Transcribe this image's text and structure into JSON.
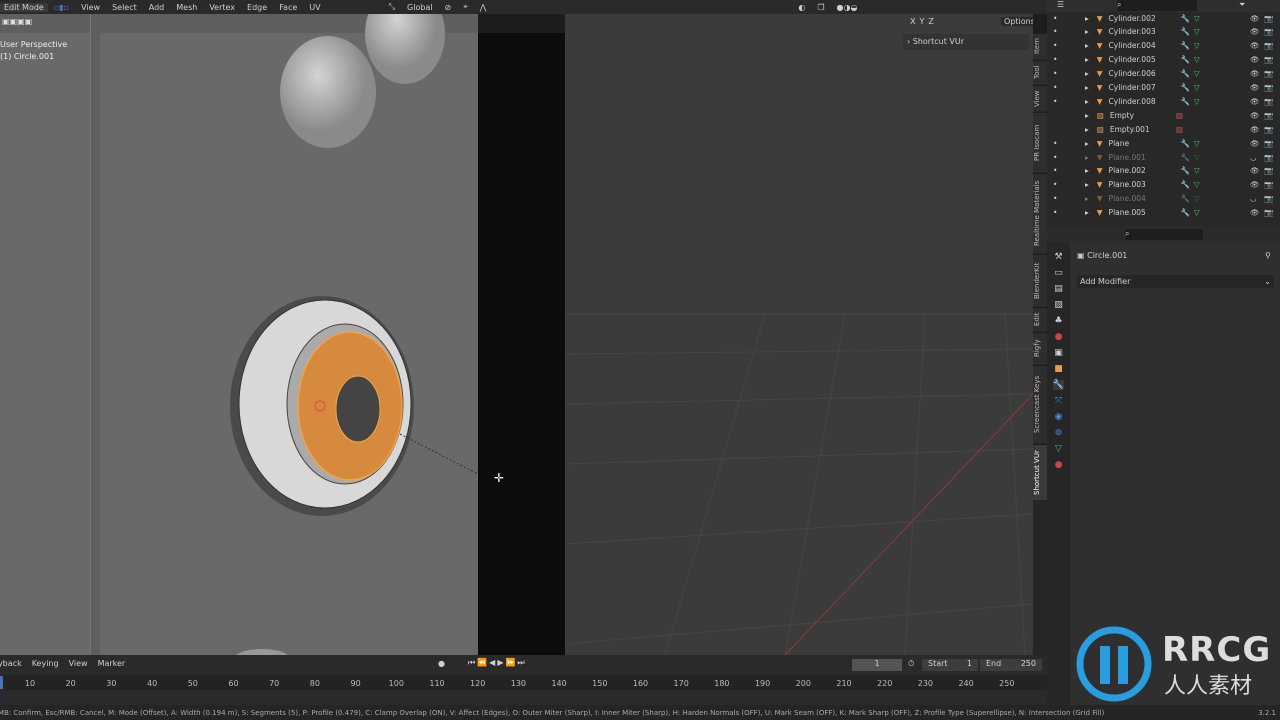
{
  "header": {
    "mode": "Edit Mode",
    "menus": [
      "View",
      "Select",
      "Add",
      "Mesh",
      "Vertex",
      "Edge",
      "Face",
      "UV"
    ],
    "orientation": "Global",
    "options": "Options",
    "axes": [
      "X",
      "Y",
      "Z"
    ]
  },
  "viewport": {
    "perspective": "User Perspective",
    "object": "(1) Circle.001"
  },
  "sidebar": {
    "panel": "Shortcut VUr",
    "tabs": [
      "Item",
      "Tool",
      "View",
      "PR Isocam",
      "Realtime Materials",
      "BlenderKit",
      "Edit",
      "Rigfy",
      "Screencast Keys",
      "Shortcut VUr"
    ]
  },
  "outliner": {
    "items": [
      {
        "name": "Cylinder.002",
        "type": "mesh",
        "dim": false
      },
      {
        "name": "Cylinder.003",
        "type": "mesh",
        "dim": false
      },
      {
        "name": "Cylinder.004",
        "type": "mesh",
        "dim": false
      },
      {
        "name": "Cylinder.005",
        "type": "mesh",
        "dim": false
      },
      {
        "name": "Cylinder.006",
        "type": "mesh",
        "dim": false
      },
      {
        "name": "Cylinder.007",
        "type": "mesh",
        "dim": false
      },
      {
        "name": "Cylinder.008",
        "type": "mesh",
        "dim": false
      },
      {
        "name": "Empty",
        "type": "empty",
        "dim": false
      },
      {
        "name": "Empty.001",
        "type": "empty",
        "dim": false
      },
      {
        "name": "Plane",
        "type": "mesh",
        "dim": false
      },
      {
        "name": "Plane.001",
        "type": "mesh",
        "dim": true
      },
      {
        "name": "Plane.002",
        "type": "mesh",
        "dim": false
      },
      {
        "name": "Plane.003",
        "type": "mesh",
        "dim": false
      },
      {
        "name": "Plane.004",
        "type": "mesh",
        "dim": true
      },
      {
        "name": "Plane.005",
        "type": "mesh",
        "dim": false
      }
    ]
  },
  "properties": {
    "object": "Circle.001",
    "add_modifier": "Add Modifier"
  },
  "timeline": {
    "menus": [
      "Playback",
      "Keying",
      "View",
      "Marker"
    ],
    "current_frame": "1",
    "start_label": "Start",
    "start": "1",
    "end_label": "End",
    "end": "250",
    "ticks": [
      "10",
      "20",
      "30",
      "40",
      "50",
      "60",
      "70",
      "80",
      "90",
      "100",
      "110",
      "120",
      "130",
      "140",
      "150",
      "160",
      "170",
      "180",
      "190",
      "200",
      "210",
      "220",
      "230",
      "240",
      "250"
    ]
  },
  "status": {
    "text": "LMB: Confirm, Esc/RMB: Cancel, M: Mode (Offset), A: Width (0.194 m), S: Segments (5), P: Profile (0.479), C: Clamp Overlap (ON), V: Affect (Edges), O: Outer Miter (Sharp), I: Inner Miter (Sharp), H: Harden Normals (OFF), U: Mark Seam (OFF), K: Mark Sharp (OFF), Z: Profile Type (Superellipse), N: Intersection (Grid Fill)",
    "version": "3.2.1"
  },
  "watermark": {
    "brand": "RRCG",
    "sub": "人人素材"
  },
  "colors": {
    "accent": "#4772b3",
    "selection": "#e8913a",
    "mesh_icon": "#e89a4a",
    "data_icon": "#36c28a",
    "watermark": "#2a9ce0"
  }
}
